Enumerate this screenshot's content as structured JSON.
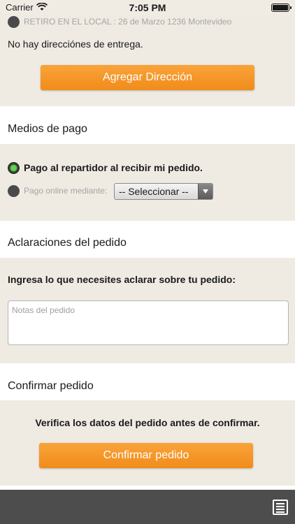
{
  "status_bar": {
    "carrier": "Carrier",
    "time": "7:05 PM"
  },
  "delivery": {
    "pickup_option": "RETIRO EN EL LOCAL : 26 de Marzo 1236 Montevideo",
    "no_addresses": "No hay direcciónes de entrega.",
    "add_address_button": "Agregar Dirección"
  },
  "payment": {
    "header": "Medios de pago",
    "option_cash": "Pago al repartidor al recibir mi pedido.",
    "option_online": "Pago online mediante:",
    "select_value": "-- Seleccionar --"
  },
  "notes": {
    "header": "Aclaraciones del pedido",
    "prompt": "Ingresa lo que necesites aclarar sobre tu pedido:",
    "placeholder": "Notas del pedido"
  },
  "confirm": {
    "header": "Confirmar pedido",
    "instruction": "Verifica los datos del pedido antes de confirmar.",
    "button": "Confirmar pedido"
  },
  "colors": {
    "accent": "#f39422",
    "panel_bg": "#efebe3",
    "bottom_bar": "#4d4d4d",
    "radio_selected": "#5ad54a"
  },
  "icons": {
    "menu": "list-icon"
  }
}
